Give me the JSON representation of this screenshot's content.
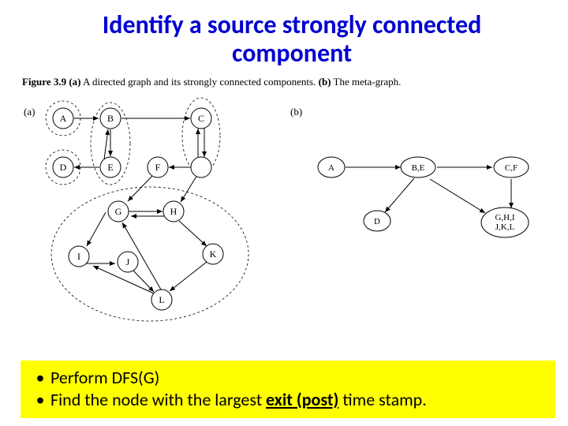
{
  "title_line1": "Identify a source strongly connected",
  "title_line2": "component",
  "caption_prefix": "Figure 3.9 (a)",
  "caption_a": " A directed graph and its strongly connected components. ",
  "caption_b_prefix": "(b)",
  "caption_b": " The meta-graph.",
  "panel_a": "(a)",
  "panel_b": "(b)",
  "nodes": {
    "A": "A",
    "B": "B",
    "C": "C",
    "D": "D",
    "E": "E",
    "F": "F",
    "G": "G",
    "H": "H",
    "I": "I",
    "J": "J",
    "K": "K",
    "L": "L"
  },
  "meta": {
    "A": "A",
    "BE": "B,E",
    "CF": "C,F",
    "D": "D",
    "GHI": "G,H,I",
    "JKL": "J,K,L"
  },
  "bullets": {
    "b1": "Perform DFS(G)",
    "b2a": "Find the node with the largest ",
    "b2b": "exit (post)",
    "b2c": " time stamp."
  }
}
